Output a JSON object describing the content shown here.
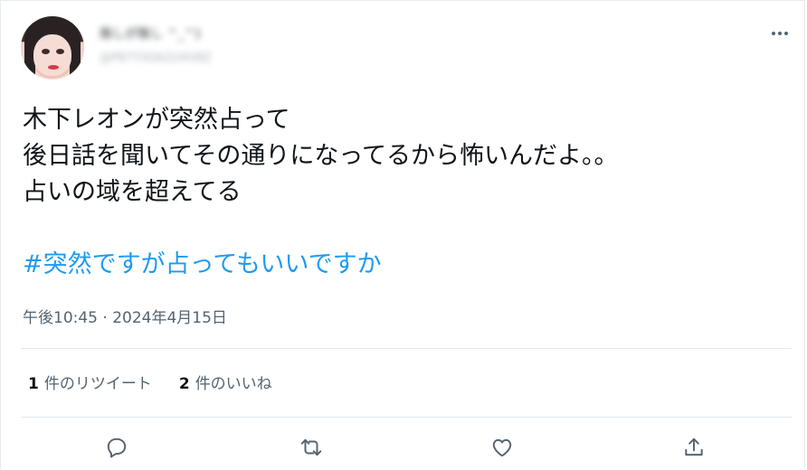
{
  "tweet": {
    "author": {
      "display_name": "推しが推し ^_^)",
      "handle": "@P87YX0A2U4V8Z"
    },
    "text_lines": [
      "木下レオンが突然占って",
      "後日話を聞いてその通りになってるから怖いんだよ。。",
      "占いの域を超えてる"
    ],
    "hashtag": "#突然ですが占ってもいいですか",
    "timestamp": "午後10:45 · 2024年4月15日",
    "stats": {
      "retweets": {
        "count": "1",
        "label": "件のリツイート"
      },
      "likes": {
        "count": "2",
        "label": "件のいいね"
      }
    }
  },
  "icons": {
    "more": "more-horizontal-icon",
    "reply": "reply-icon",
    "retweet": "retweet-icon",
    "like": "heart-icon",
    "share": "share-icon"
  },
  "colors": {
    "accent": "#1d9bf0",
    "text": "#0f1419",
    "secondary": "#536471",
    "divider": "#e1e8ed"
  }
}
